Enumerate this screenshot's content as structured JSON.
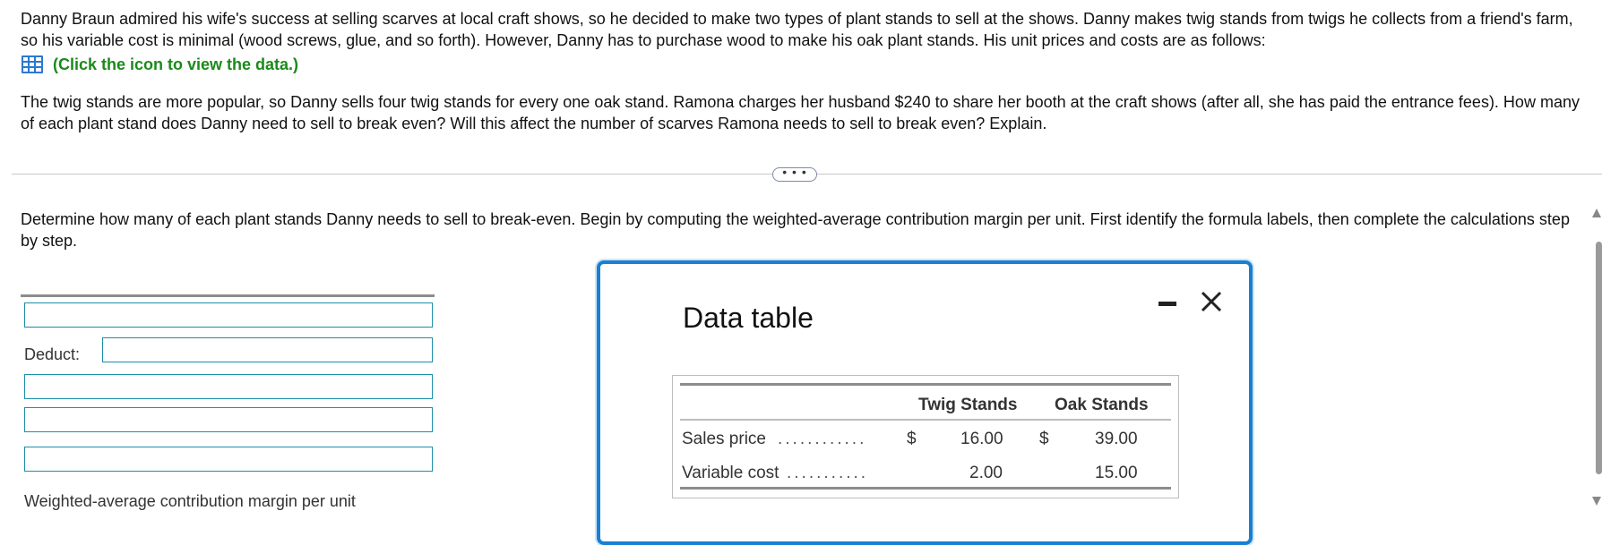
{
  "problem": {
    "paragraph1": "Danny Braun admired his wife's success at selling scarves at local craft shows, so he decided to make two types of plant stands to sell at the shows. Danny makes twig stands from twigs he collects from a friend's farm, so his variable cost is minimal (wood screws, glue, and so forth). However, Danny has to purchase wood to make his oak plant stands. His unit prices and costs are as follows:",
    "data_link_label": "(Click the icon to view the data.)",
    "paragraph2": "The twig stands are more popular, so Danny sells four twig stands for every one oak stand. Ramona charges her husband $240 to share her booth at the craft shows (after all, she has paid the entrance fees). How many of each plant stand does Danny need to sell to break even? Will this affect the number of scarves Ramona needs to sell to break even? Explain."
  },
  "expand_button": "• • •",
  "instructions": "Determine how many of each plant stands Danny needs to sell to break-even. Begin by computing the weighted-average contribution margin per unit. First identify the formula labels, then complete the calculations step by step.",
  "form": {
    "deduct_label": "Deduct:",
    "result_label": "Weighted-average contribution margin per unit"
  },
  "modal": {
    "title": "Data table",
    "table": {
      "columns": [
        "Twig Stands",
        "Oak Stands"
      ],
      "rows": [
        {
          "label": "Sales price",
          "dots": "............",
          "currency": "$",
          "twig": "16.00",
          "oak_currency": "$",
          "oak": "39.00"
        },
        {
          "label": "Variable cost",
          "dots": "...........",
          "currency": "",
          "twig": "2.00",
          "oak_currency": "",
          "oak": "15.00"
        }
      ]
    }
  },
  "colors": {
    "link_green": "#1a8a1a",
    "input_border": "#1d8fa8",
    "modal_border": "#1a7fd0"
  },
  "icons": [
    "table-grid-icon",
    "minimize-icon",
    "close-icon"
  ]
}
